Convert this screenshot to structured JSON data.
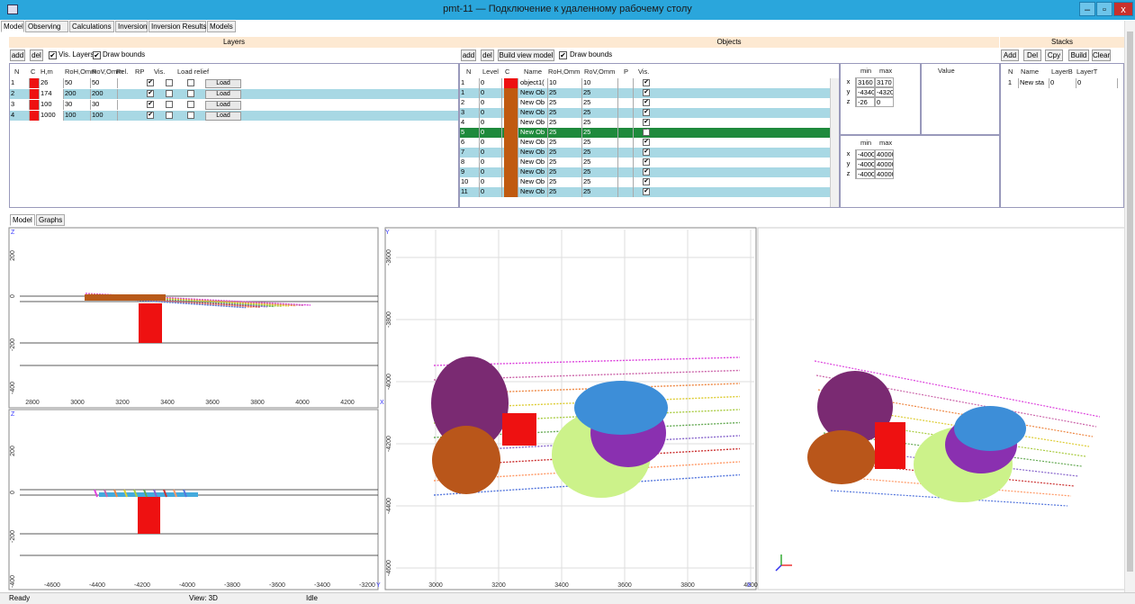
{
  "window": {
    "title": "pmt-11 — Подключение к удаленному рабочему столу",
    "min": "–",
    "max": "▫",
    "close": "x"
  },
  "tabs": [
    "Model",
    "Observing",
    "Calculations",
    "Inversion",
    "Inversion Results",
    "Models"
  ],
  "layers": {
    "title": "Layers",
    "add": "add",
    "del": "del",
    "vis_layers": "Vis. Layers",
    "draw_bounds": "Draw bounds",
    "columns": [
      "N",
      "C",
      "H,m",
      "RoH,Omm",
      "RoV,Omm",
      "Rel.",
      "RP",
      "Vis.",
      "Load relief"
    ],
    "load_label": "Load",
    "rows": [
      {
        "n": "1",
        "h": "26",
        "roh": "50",
        "rov": "50",
        "rel": true,
        "rp": false,
        "vis": false
      },
      {
        "n": "2",
        "h": "174",
        "roh": "200",
        "rov": "200",
        "rel": true,
        "rp": false,
        "vis": false
      },
      {
        "n": "3",
        "h": "100",
        "roh": "30",
        "rov": "30",
        "rel": true,
        "rp": false,
        "vis": false
      },
      {
        "n": "4",
        "h": "1000",
        "roh": "100",
        "rov": "100",
        "rel": true,
        "rp": false,
        "vis": false
      }
    ]
  },
  "objects": {
    "title": "Objects",
    "add": "add",
    "del": "del",
    "build_view": "Build view model",
    "draw_bounds": "Draw bounds",
    "columns": [
      "N",
      "Level",
      "C",
      "Name",
      "RoH,Omm",
      "RoV,Omm",
      "P",
      "Vis."
    ],
    "rows": [
      {
        "n": "1",
        "level": "0",
        "name": "object1(",
        "roh": "10",
        "rov": "10"
      },
      {
        "n": "1",
        "level": "0",
        "name": "New Ob",
        "roh": "25",
        "rov": "25"
      },
      {
        "n": "2",
        "level": "0",
        "name": "New Ob",
        "roh": "25",
        "rov": "25"
      },
      {
        "n": "3",
        "level": "0",
        "name": "New Ob",
        "roh": "25",
        "rov": "25"
      },
      {
        "n": "4",
        "level": "0",
        "name": "New Ob",
        "roh": "25",
        "rov": "25"
      },
      {
        "n": "5",
        "level": "0",
        "name": "New Ob",
        "roh": "25",
        "rov": "25"
      },
      {
        "n": "6",
        "level": "0",
        "name": "New Ob",
        "roh": "25",
        "rov": "25"
      },
      {
        "n": "7",
        "level": "0",
        "name": "New Ob",
        "roh": "25",
        "rov": "25"
      },
      {
        "n": "8",
        "level": "0",
        "name": "New Ob",
        "roh": "25",
        "rov": "25"
      },
      {
        "n": "9",
        "level": "0",
        "name": "New Ob",
        "roh": "25",
        "rov": "25"
      },
      {
        "n": "10",
        "level": "0",
        "name": "New Ob",
        "roh": "25",
        "rov": "25"
      },
      {
        "n": "11",
        "level": "0",
        "name": "New Ob",
        "roh": "25",
        "rov": "25"
      }
    ],
    "bounds1": {
      "min": "min",
      "max": "max",
      "value": "Value",
      "rows": [
        [
          "x",
          "3160",
          "3170"
        ],
        [
          "y",
          "-4340",
          "-4320"
        ],
        [
          "z",
          "-26",
          "0"
        ]
      ]
    },
    "bounds2": {
      "min": "min",
      "max": "max",
      "rows": [
        [
          "x",
          "-4000",
          "40000"
        ],
        [
          "y",
          "-4000",
          "40000"
        ],
        [
          "z",
          "-4000",
          "40000"
        ]
      ]
    }
  },
  "stacks": {
    "title": "Stacks",
    "buttons": [
      "Add",
      "Del",
      "Cpy",
      "Build",
      "Clear"
    ],
    "columns": [
      "N",
      "Name",
      "LayerB",
      "LayerT"
    ],
    "rows": [
      {
        "n": "1",
        "name": "New sta",
        "lb": "0",
        "lt": "0"
      }
    ]
  },
  "view_tabs": [
    "Model",
    "Graphs"
  ],
  "plots": {
    "xz_x_ticks": [
      "2800",
      "3000",
      "3200",
      "3400",
      "3600",
      "3800",
      "4000",
      "4200"
    ],
    "xz_z_ticks": [
      "200",
      "0",
      "-200",
      "-400"
    ],
    "yz_y_ticks": [
      "-4600",
      "-4400",
      "-4200",
      "-4000",
      "-3800",
      "-3600",
      "-3400",
      "-3200"
    ],
    "yz_z_ticks": [
      "200",
      "0",
      "-200",
      "-400"
    ],
    "xy_x_ticks": [
      "3000",
      "3200",
      "3400",
      "3600",
      "3800",
      "4000"
    ],
    "xy_y_ticks": [
      "-3600",
      "-3800",
      "-4000",
      "-4200",
      "-4400",
      "-4600"
    ],
    "axis_x": "X",
    "axis_y": "Y",
    "axis_z": "Z"
  },
  "status": {
    "ready": "Ready",
    "view": "View: 3D",
    "state": "Idle"
  },
  "colors": {
    "title_bar": "#2aa6dc",
    "selected_row": "#a8d8e4",
    "highlight_row": "#1e8a3c",
    "layer_color": "#ee1111",
    "object_color": "#c05a10",
    "band": "#fde9d2"
  }
}
